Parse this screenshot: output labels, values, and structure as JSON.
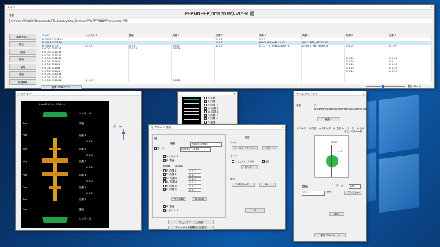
{
  "main": {
    "tab": "メイン",
    "title": "PPPNNPPP(nnnnnrrr).VIA-8 層",
    "file_label": "名前",
    "file_path": "C:¥Users¥Public¥Documents¥ToolLibrary¥Via_Terminal¥Via¥PPPNNPPP(nnnnnrrr).VIA",
    "side_buttons": [
      "新規作成...",
      "修正...",
      "削除",
      "検索...",
      "保存",
      "複製...",
      "新規構成"
    ],
    "columns": [
      "ホール",
      "レジスト 1",
      "表面",
      "内層 1",
      "内層 2",
      "内層 3",
      "内層 4",
      "内層 5",
      "内層 6"
    ],
    "rows": [
      [
        "D  ∅ 0.25  ∅ 13-14",
        "",
        "",
        "",
        "∅ 0.5",
        "∅ 0.5",
        "",
        "",
        ""
      ],
      [
        "D  ∅ 0.4  ∅ 13-14",
        "",
        "",
        "",
        "∅ 0.7",
        "JYA-CLR05_sMT1 0.0°",
        "JYA-CLR05_sMT1 0.0°",
        "",
        ""
      ],
      [
        "D  ∅ 0.5  ∅ 7-8",
        "∅ 1.2",
        "∅ 1.0",
        "∅ 1.0",
        "∅ 1.0",
        "∅ 1.2  T_T_Sect-140.sPT1",
        "∅ 1.0  T_Twi-140.sPT1",
        "∅ 1.0",
        "∅ 1.0"
      ],
      [
        "P  ∅ 0.1  ∅ 11-14",
        "",
        "∅ 0.25",
        "∅ 0.25",
        "",
        "",
        "",
        "",
        ""
      ],
      [
        "P  ∅ 0.1  ∅ 11-13",
        "",
        "",
        "",
        "",
        "",
        "",
        "",
        ""
      ],
      [
        "P  ∅ 0.1  ∅ 10-11",
        "",
        "",
        "",
        "",
        "",
        "",
        "",
        ""
      ],
      [
        "P  ∅ 0.1  ∅ 12-13",
        "",
        "",
        "",
        "",
        "",
        "",
        "∅ 0.25",
        "∅ 0.25"
      ],
      [
        "P  ∅ 0.1  ∅ 14-4",
        "",
        "",
        "",
        "",
        "",
        "",
        "∅ 0.25",
        "∅ 0.1"
      ],
      [
        "P  ∅ 0.1  ∅ 14-3",
        "",
        "",
        "",
        "",
        "",
        "",
        "∅ 0.25",
        "∅ 0.25"
      ],
      [
        "P  ∅ 0.1  ∅ 14-6",
        "",
        "",
        "",
        "",
        "",
        "",
        "∅ 0.25",
        "∅ 0.25"
      ],
      [
        "P  ∅ 0.1  ∅ 14-1",
        "",
        "",
        "",
        "",
        "",
        "",
        "∅ 0.25",
        "∅ 0.25"
      ],
      [
        "P  ∅ 0.1  ∅ 10-13",
        "",
        "",
        "",
        "",
        "",
        "",
        "",
        ""
      ],
      [
        "P  ∅ 0.1  ∅ 11-12",
        "",
        "",
        "",
        "",
        "",
        "",
        "",
        ""
      ],
      [
        "P  ∅ 0.1  ∅ 10-11",
        "∅ 0.25",
        "",
        "∅ 0.25",
        "",
        "",
        "",
        "",
        ""
      ]
    ],
    "help_button": "参考 Web ページ",
    "zoom_label": "表示 100 %"
  },
  "preview": {
    "title": "ビアビュー",
    "header": "Hole D  ∅ 0.4  ∅ 13-14",
    "layers": [
      {
        "left": "",
        "right": "レジスト 1"
      },
      {
        "left": "Pool",
        "right": "表面"
      },
      {
        "left": "Pool",
        "right": "内層 1"
      },
      {
        "left": "Neg",
        "right": "内層 2"
      },
      {
        "left": "Neg",
        "right": "内層 3"
      },
      {
        "left": "Pool",
        "right": "内層 4"
      },
      {
        "left": "Pool",
        "right": "内層 5"
      },
      {
        "left": "Pool",
        "right": "内層 6"
      },
      {
        "left": "Pool",
        "right": "裏面"
      },
      {
        "left": "",
        "right": "レジスト 2"
      }
    ],
    "values": [
      "∅ 1.0",
      "∅ 1.0",
      "∅ 1.0",
      "∅ 1.0",
      "∅ 1.0"
    ],
    "zoom_label": "ズーム"
  },
  "layer_popup": {
    "items": [
      "P- 表面",
      "P- 内層 1",
      "P- 内層 2",
      "N- 内層 3",
      "N- 内層 4",
      "P- 内層 5",
      "P- 内層 6",
      "P- 裏面"
    ],
    "ok": "Ok"
  },
  "edit": {
    "title": "ビアホール 作成",
    "layer_group": "層",
    "copy_label": "複製",
    "copy_value": "内層 3 - 内層 4",
    "hole_label": "ホール",
    "hole_value": "D  0.4  ∅ 13-14",
    "resist1": "レジスト 1",
    "surface": "P- 表面",
    "inner_title": "銅箔種",
    "size_title": "重箔幅",
    "inner_rows": [
      {
        "name": "P- 内層 1",
        "val": "∅ 0.7"
      },
      {
        "name": "P- 内層 2",
        "val": "∅ 0.7"
      },
      {
        "name": "N- 内層 3",
        "val": "∅ 1.4"
      },
      {
        "name": "N- 内層 4",
        "val": "∅ 1.4"
      },
      {
        "name": "P- 内層 5",
        "val": "∅ 0.7"
      },
      {
        "name": "P- 内層 6",
        "val": "∅ 0.7"
      }
    ],
    "select_all": "全ての層",
    "deselect": "全ての層",
    "back": "P- 裏面",
    "resist2": "レジスト 2",
    "bulk_set": "チェックマーク全削除",
    "from_hole": "ホールからの距離で一括設定",
    "fix_label": "修正",
    "tool_label": "ツール",
    "tool_btn": "ツールライブラリ...",
    "copy_btn": "コピー...",
    "clear_label": "クリアー",
    "check_text": "チェックマークのみ",
    "all_text": "全層",
    "clear_btn": "クリアー",
    "display_label": "表示",
    "cad_btn": "CAD データ...",
    "threed_btn": "3D...",
    "ok": "Ok"
  },
  "hole": {
    "title": "ホールライブラリ",
    "name_label": "名前",
    "path": "C:¥Users¥Public¥Documents¥ToolLibrary¥Tool",
    "edit_btn": "編集...",
    "tabs": [
      "ドリルホール 円形",
      "カスタムホール 長方",
      "レーザーホール カスタム パラメータ"
    ],
    "dim_top": "0.54",
    "dim_side": "1.14",
    "diam_label": "直径",
    "diam_value": "∅ 0.4",
    "unit": "mm",
    "zoom_label": "ズーム",
    "zoom_value": "x2.0",
    "preview_btn": "プレビュー",
    "close_btn": "閉る",
    "help_btn": "参考 Web ページ"
  }
}
